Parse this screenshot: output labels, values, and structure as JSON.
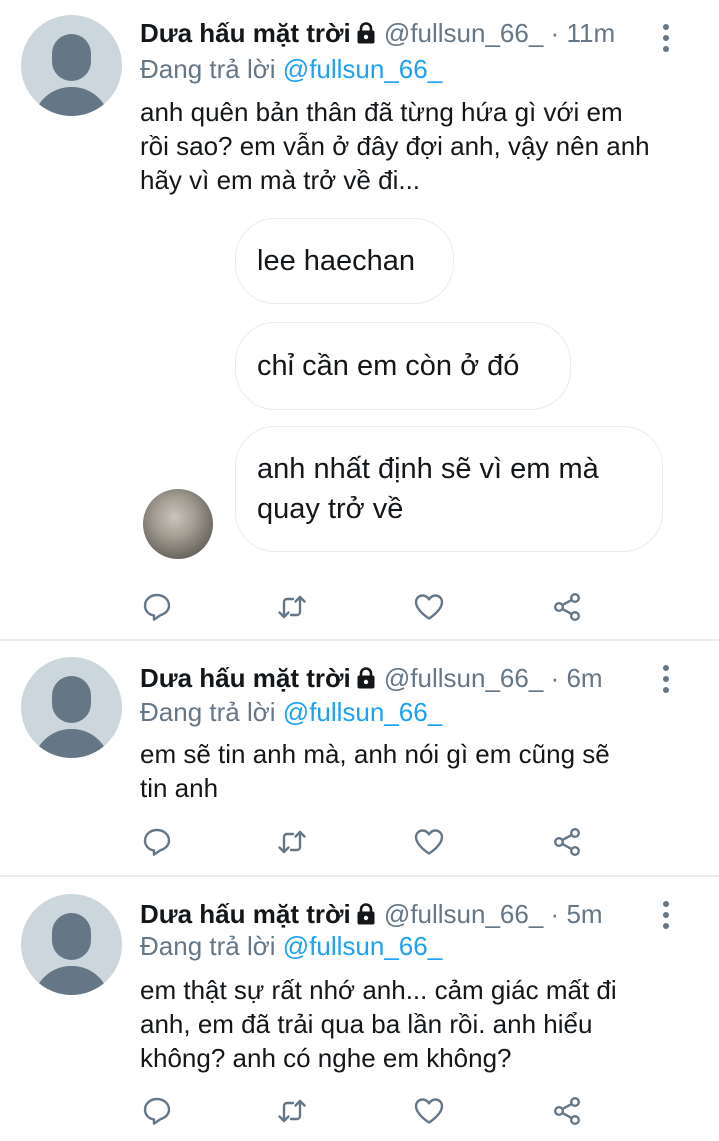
{
  "tweets": [
    {
      "author": "Dưa hấu mặt trời",
      "handle": "@fullsun_66_",
      "separator": "·",
      "time": "11m",
      "reply_prefix": "Đang trả lời",
      "reply_to": "@fullsun_66_",
      "text": "anh quên bản thân đã từng hứa gì với em\nrồi sao? em vẫn ở đây đợi anh, vậy nên anh\nhãy vì em mà trở về đi...",
      "chat_bubbles": [
        "lee haechan",
        "chỉ cần em còn ở đó",
        "anh nhất định sẽ vì em mà\nquay trở về"
      ]
    },
    {
      "author": "Dưa hấu mặt trời",
      "handle": "@fullsun_66_",
      "separator": "·",
      "time": "6m",
      "reply_prefix": "Đang trả lời",
      "reply_to": "@fullsun_66_",
      "text": "em sẽ tin anh mà, anh nói gì em cũng sẽ\ntin anh"
    },
    {
      "author": "Dưa hấu mặt trời",
      "handle": "@fullsun_66_",
      "separator": "·",
      "time": "5m",
      "reply_prefix": "Đang trả lời",
      "reply_to": "@fullsun_66_",
      "text": "em thật sự rất nhớ anh... cảm giác mất đi\nanh, em đã trải qua ba lần rồi. anh hiểu\nkhông? anh có nghe em không?"
    }
  ],
  "colors": {
    "text": "#14171a",
    "secondary": "#657786",
    "link": "#1da1f2",
    "divider": "#e6ecf0",
    "avatar_bg": "#ccd6dd"
  },
  "icons": [
    "lock-icon",
    "more-options-icon",
    "reply-icon",
    "retweet-icon",
    "like-icon",
    "share-icon"
  ]
}
